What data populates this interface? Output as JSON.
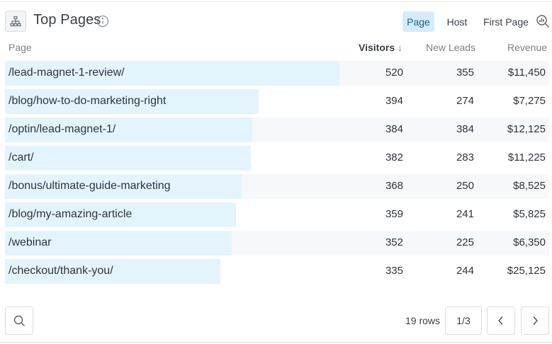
{
  "header": {
    "title": "Top Pages",
    "icons": [
      "sitemap-icon",
      "info-icon",
      "zoom-icon"
    ],
    "tabs": [
      {
        "label": "Page",
        "active": true
      },
      {
        "label": "Host",
        "active": false
      },
      {
        "label": "First Page",
        "active": false
      }
    ]
  },
  "table": {
    "columns": {
      "page": "Page",
      "visitors": "Visitors",
      "visitors_sort": "↓",
      "new_leads": "New Leads",
      "revenue": "Revenue"
    },
    "rows": [
      {
        "page": "/lead-magnet-1-review/",
        "visitors": "520",
        "new_leads": "355",
        "revenue": "$11,450"
      },
      {
        "page": "/blog/how-to-do-marketing-right",
        "visitors": "394",
        "new_leads": "274",
        "revenue": "$7,275"
      },
      {
        "page": "/optin/lead-magnet-1/",
        "visitors": "384",
        "new_leads": "384",
        "revenue": "$12,125"
      },
      {
        "page": "/cart/",
        "visitors": "382",
        "new_leads": "283",
        "revenue": "$11,225"
      },
      {
        "page": "/bonus/ultimate-guide-marketing",
        "visitors": "368",
        "new_leads": "250",
        "revenue": "$8,525"
      },
      {
        "page": "/blog/my-amazing-article",
        "visitors": "359",
        "new_leads": "241",
        "revenue": "$5,825"
      },
      {
        "page": "/webinar",
        "visitors": "352",
        "new_leads": "225",
        "revenue": "$6,350"
      },
      {
        "page": "/checkout/thank-you/",
        "visitors": "335",
        "new_leads": "244",
        "revenue": "$25,125"
      }
    ]
  },
  "footer": {
    "rows_count": "19 rows",
    "page_indicator": "1/3",
    "icons": [
      "search-icon",
      "chevron-left-icon",
      "chevron-right-icon"
    ]
  },
  "colors": {
    "bar": "#e3f4fd",
    "active_tab_bg": "#d4ecfb",
    "alt_row": "#f6f8fa"
  }
}
